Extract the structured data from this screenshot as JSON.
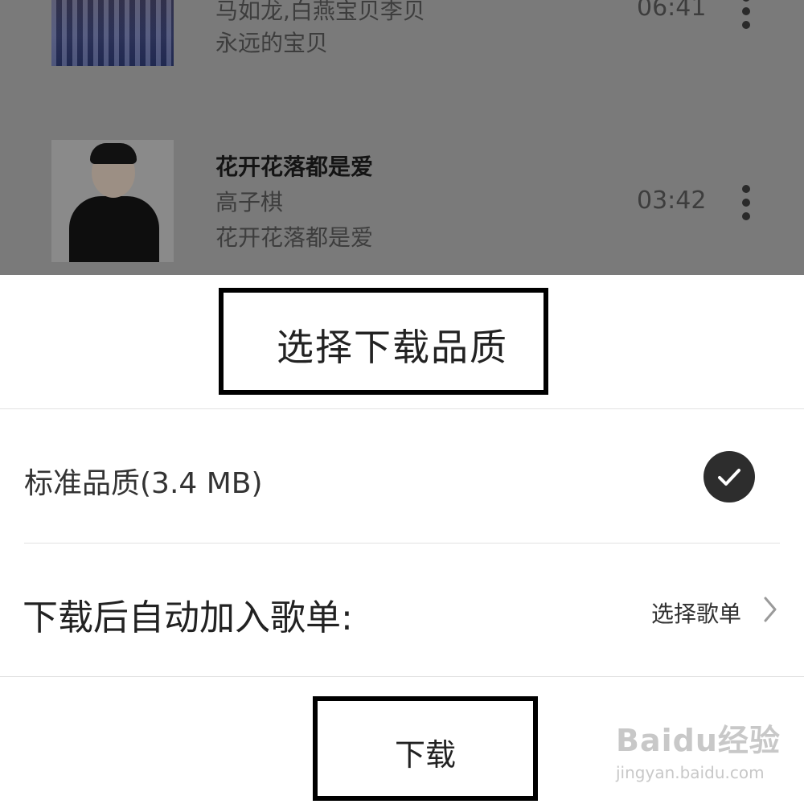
{
  "background_list": {
    "songs": [
      {
        "artist_line": "马如龙,白燕宝贝李贝",
        "album": "永远的宝贝",
        "duration": "06:41",
        "cover": "crowd-photo"
      },
      {
        "title": "花开花落都是爱",
        "artist": "高子棋",
        "album": "花开花落都是爱",
        "duration": "03:42",
        "cover": "portrait-photo"
      }
    ]
  },
  "sheet": {
    "title": "选择下载品质",
    "quality_option": "标准品质(3.4 MB)",
    "playlist_label": "下载后自动加入歌单:",
    "select_playlist": "选择歌单",
    "download_button": "下载"
  },
  "watermark": {
    "brand": "Baidu经验",
    "url": "jingyan.baidu.com"
  },
  "colors": {
    "overlay_gray": "#7a7a7a",
    "check_bg": "#2d2d2d",
    "highlight_border": "#000000"
  }
}
